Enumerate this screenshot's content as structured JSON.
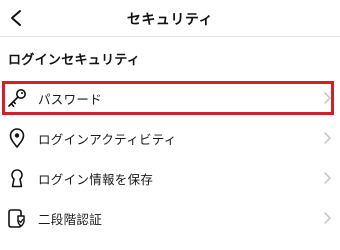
{
  "header": {
    "title": "セキュリティ",
    "back_icon": "chevron-left-icon"
  },
  "section": {
    "title": "ログインセキュリティ"
  },
  "items": [
    {
      "label": "パスワード",
      "icon": "key-icon",
      "highlighted": true
    },
    {
      "label": "ログインアクティビティ",
      "icon": "location-pin-icon"
    },
    {
      "label": "ログイン情報を保存",
      "icon": "keyhole-icon"
    },
    {
      "label": "二段階認証",
      "icon": "shield-phone-icon"
    }
  ],
  "colors": {
    "highlight": "#d0202a",
    "chevron": "#c4c4c4",
    "text": "#111111"
  }
}
